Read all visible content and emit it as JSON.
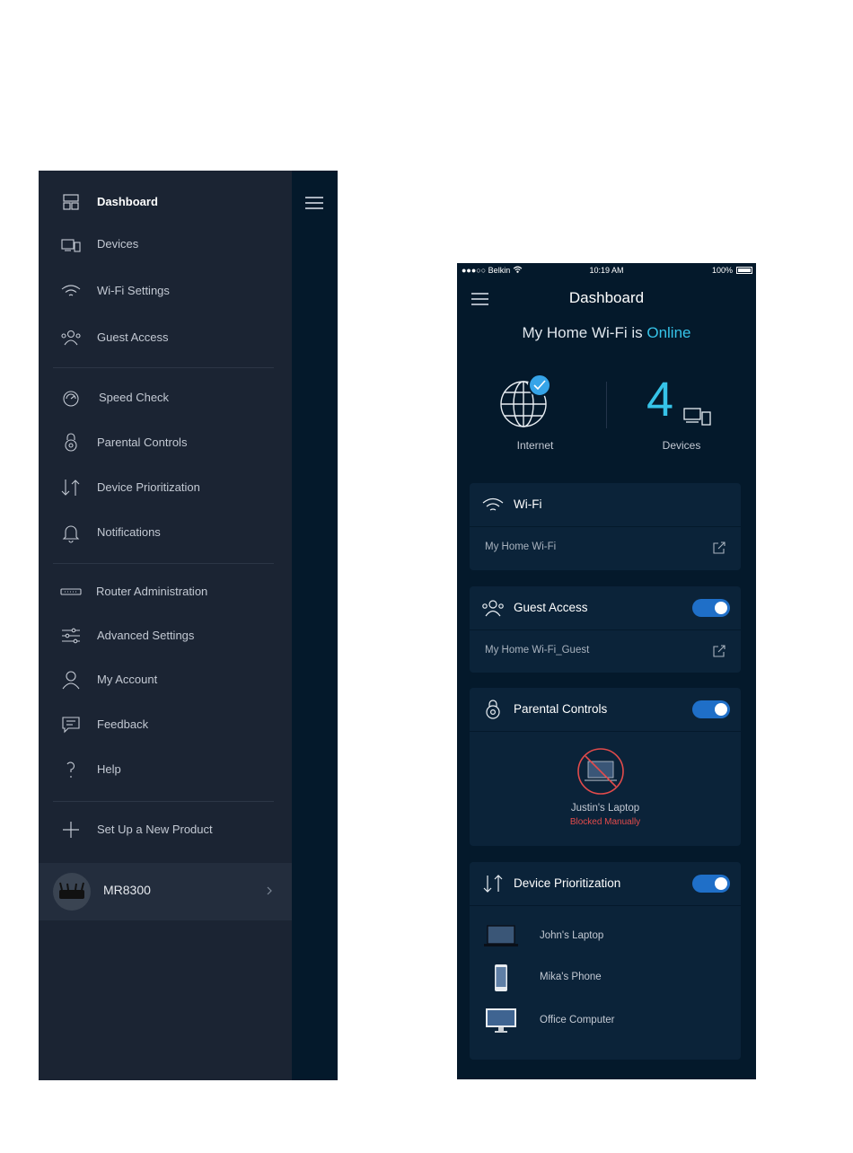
{
  "drawer": {
    "items": [
      {
        "label": "Dashboard",
        "icon": "dashboard-icon",
        "active": true
      },
      {
        "label": "Devices",
        "icon": "devices-icon"
      },
      {
        "label": "Wi-Fi Settings",
        "icon": "wifi-icon"
      },
      {
        "label": "Guest Access",
        "icon": "guest-access-icon"
      },
      {
        "label": "Speed Check",
        "icon": "speed-check-icon"
      },
      {
        "label": "Parental Controls",
        "icon": "parental-controls-icon"
      },
      {
        "label": "Device Prioritization",
        "icon": "prioritization-icon"
      },
      {
        "label": "Notifications",
        "icon": "bell-icon"
      },
      {
        "label": "Router Administration",
        "icon": "router-icon"
      },
      {
        "label": "Advanced Settings",
        "icon": "sliders-icon"
      },
      {
        "label": "My Account",
        "icon": "user-icon"
      },
      {
        "label": "Feedback",
        "icon": "chat-icon"
      },
      {
        "label": "Help",
        "icon": "question-icon"
      },
      {
        "label": "Set Up a New Product",
        "icon": "plus-icon"
      }
    ],
    "product": {
      "name": "MR8300"
    }
  },
  "phone": {
    "status_bar": {
      "carrier": "●●●○○ Belkin",
      "time": "10:19 AM",
      "battery": "100%"
    },
    "title": "Dashboard",
    "online_prefix": "My Home Wi-Fi is",
    "online_status": "Online",
    "internet_label": "Internet",
    "device_count": "4",
    "devices_label": "Devices",
    "wifi": {
      "title": "Wi-Fi",
      "network": "My Home Wi-Fi"
    },
    "guest": {
      "title": "Guest Access",
      "network": "My Home Wi-Fi_Guest",
      "enabled": true
    },
    "parental": {
      "title": "Parental Controls",
      "enabled": true,
      "device": "Justin's Laptop",
      "status": "Blocked Manually"
    },
    "prioritization": {
      "title": "Device Prioritization",
      "enabled": true,
      "devices": [
        {
          "label": "John's Laptop",
          "icon": "laptop-icon"
        },
        {
          "label": "Mika's Phone",
          "icon": "phone-icon"
        },
        {
          "label": "Office Computer",
          "icon": "monitor-icon"
        }
      ]
    }
  },
  "colors": {
    "drawer_bg": "#1b2433",
    "app_bg": "#04192b",
    "card_bg": "#0b2339",
    "accent": "#36c3e8",
    "toggle_on": "#1f6fc8",
    "blocked": "#e24b4b"
  }
}
